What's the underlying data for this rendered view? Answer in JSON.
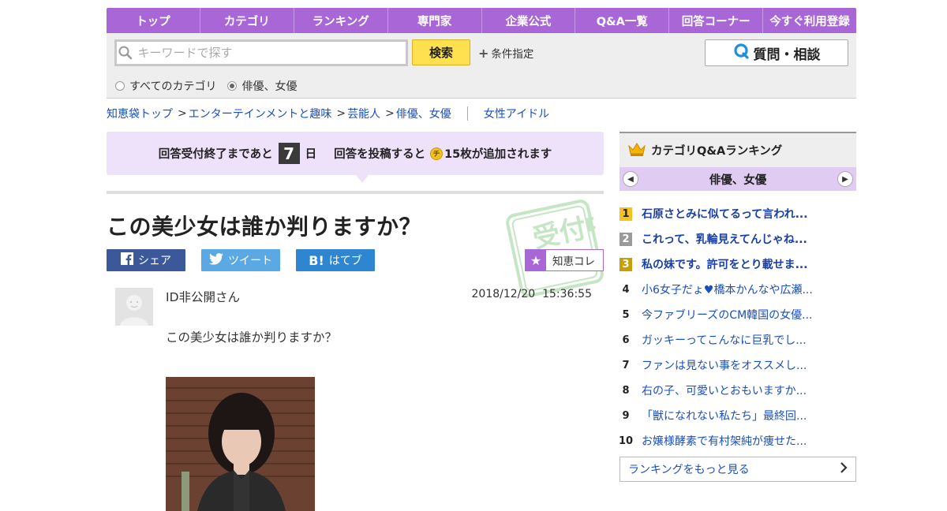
{
  "nav": [
    "トップ",
    "カテゴリ",
    "ランキング",
    "専門家",
    "企業公式",
    "Q&A一覧",
    "回答コーナー",
    "今すぐ利用登録"
  ],
  "search": {
    "placeholder": "キーワードで探す",
    "button": "検索",
    "condition": "条件指定",
    "ask_button": "質問・相談",
    "radio_all": "すべてのカテゴリ",
    "radio_current": "俳優、女優"
  },
  "breadcrumb": {
    "items": [
      "知恵袋トップ",
      "エンターテインメントと趣味",
      "芸能人",
      "俳優、女優"
    ],
    "extra": "女性アイドル"
  },
  "deadline": {
    "prefix": "回答受付終了まであと",
    "days": "7",
    "day_unit": "日",
    "post_text": "回答を投稿すると",
    "coin_icon": "チ",
    "reward": "15枚が追加されます"
  },
  "stamp_text": "受付中",
  "question": {
    "title": "この美少女は誰か判りますか？",
    "poster": "ID非公開さん",
    "date": "2018/12/20",
    "time": "15:36:55",
    "body": "この美少女は誰か判りますか？"
  },
  "share": {
    "facebook": "シェア",
    "twitter": "ツイート",
    "hatena": "はてブ",
    "hatena_mark": "B!",
    "chie_coll": "知恵コレ"
  },
  "ranking": {
    "title": "カテゴリQ&Aランキング",
    "category": "俳優、女優",
    "items": [
      {
        "num": "1",
        "title": "石原さとみに似てるって言われ..."
      },
      {
        "num": "2",
        "title": "これって、乳輪見えてんじゃね..."
      },
      {
        "num": "3",
        "title": "私の妹です。許可をとり載せま..."
      },
      {
        "num": "4",
        "title": "小6女子だょ♥橋本かんなや広瀬..."
      },
      {
        "num": "5",
        "title": "今ファブリーズのCM韓国の女優..."
      },
      {
        "num": "6",
        "title": "ガッキーってこんなに巨乳でし..."
      },
      {
        "num": "7",
        "title": "ファンは見ない事をオススメし..."
      },
      {
        "num": "8",
        "title": "右の子、可愛いとおもいますか..."
      },
      {
        "num": "9",
        "title": "「獣になれない私たち」最終回..."
      },
      {
        "num": "10",
        "title": "お嬢様酵素で有村架純が痩せた..."
      }
    ],
    "more": "ランキングをもっと見る"
  },
  "colors": {
    "accent": "#a866d6",
    "deadline_bg": "#eee2fa",
    "search_button": "#ffe14f"
  }
}
